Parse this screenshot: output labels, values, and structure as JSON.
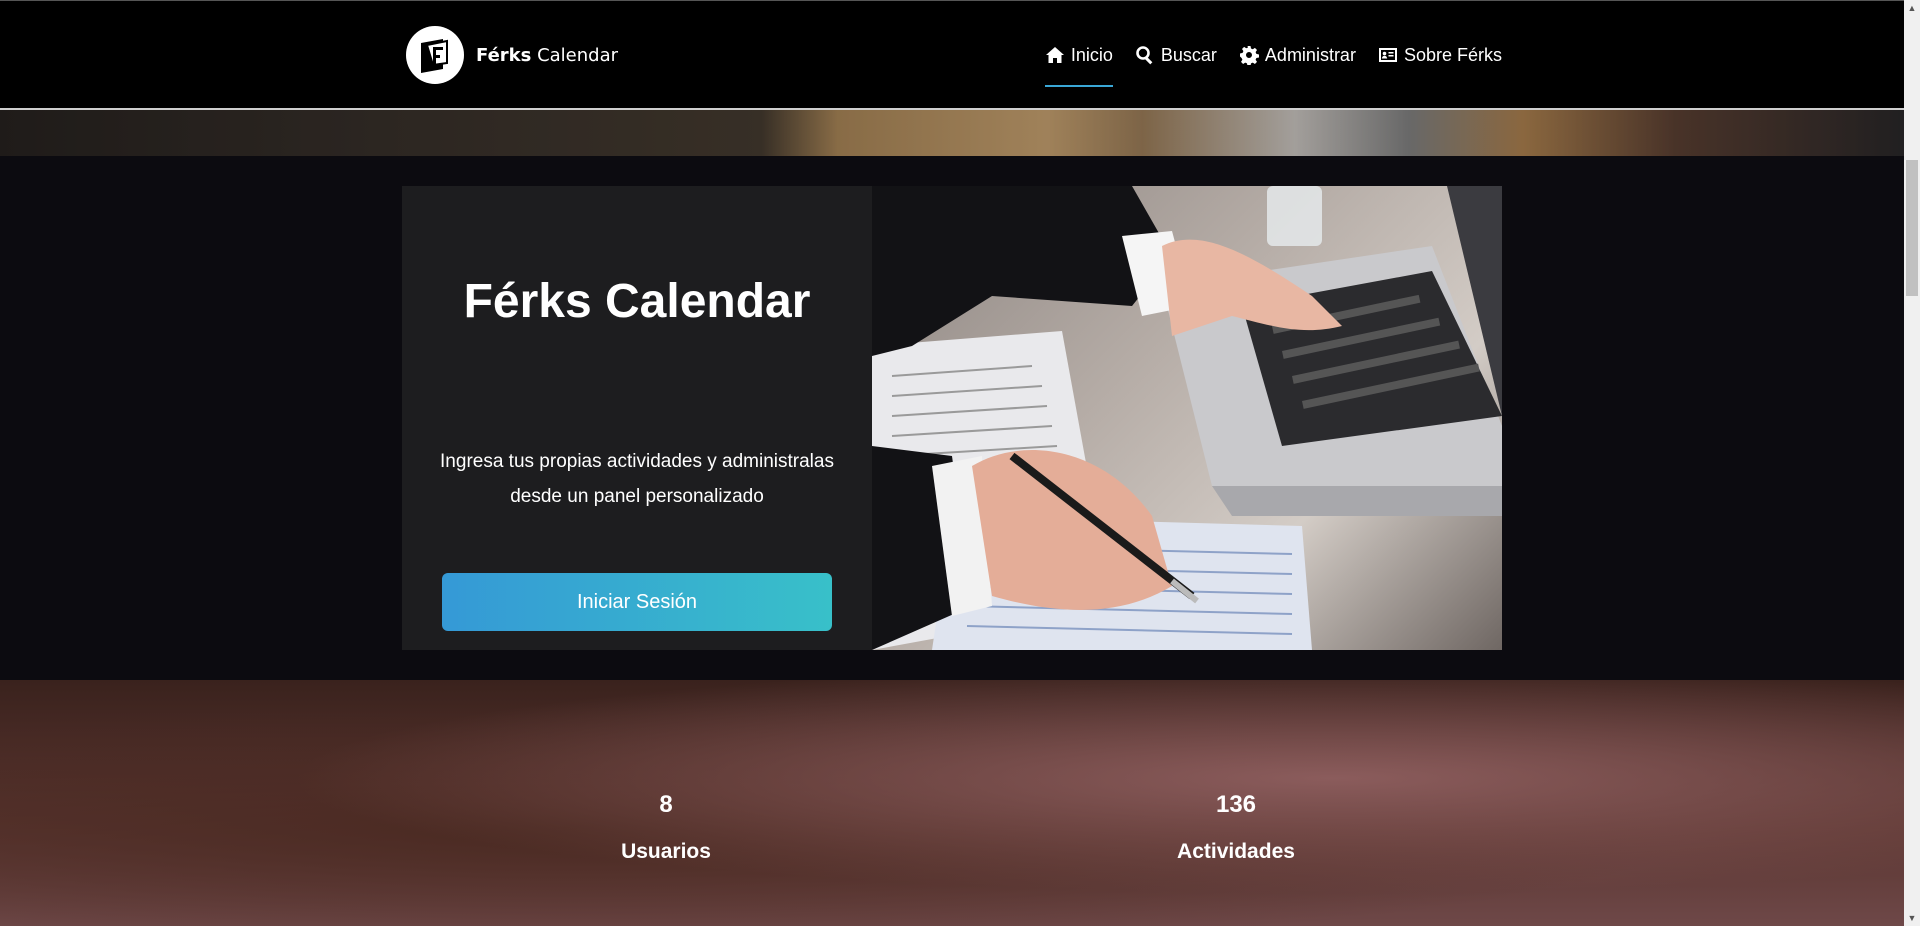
{
  "brand": {
    "name_bold": "Férks",
    "name_rest": " Calendar",
    "logo_icon": "ferks-logo-icon"
  },
  "nav": {
    "items": [
      {
        "label": "Inicio",
        "icon": "home-icon",
        "active": true
      },
      {
        "label": "Buscar",
        "icon": "search-icon",
        "active": false
      },
      {
        "label": "Administrar",
        "icon": "gear-icon",
        "active": false
      },
      {
        "label": "Sobre Férks",
        "icon": "id-card-icon",
        "active": false
      }
    ]
  },
  "hero": {
    "title": "Férks Calendar",
    "description": "Ingresa tus propias actividades y administralas desde un panel personalizado",
    "login_button": "Iniciar Sesión"
  },
  "stats": [
    {
      "value": "8",
      "label": "Usuarios"
    },
    {
      "value": "136",
      "label": "Actividades"
    }
  ],
  "colors": {
    "accent": "#3aa7d6",
    "button_start": "#3599d6",
    "button_end": "#38c0c9",
    "card_bg": "#1d1d1f"
  }
}
